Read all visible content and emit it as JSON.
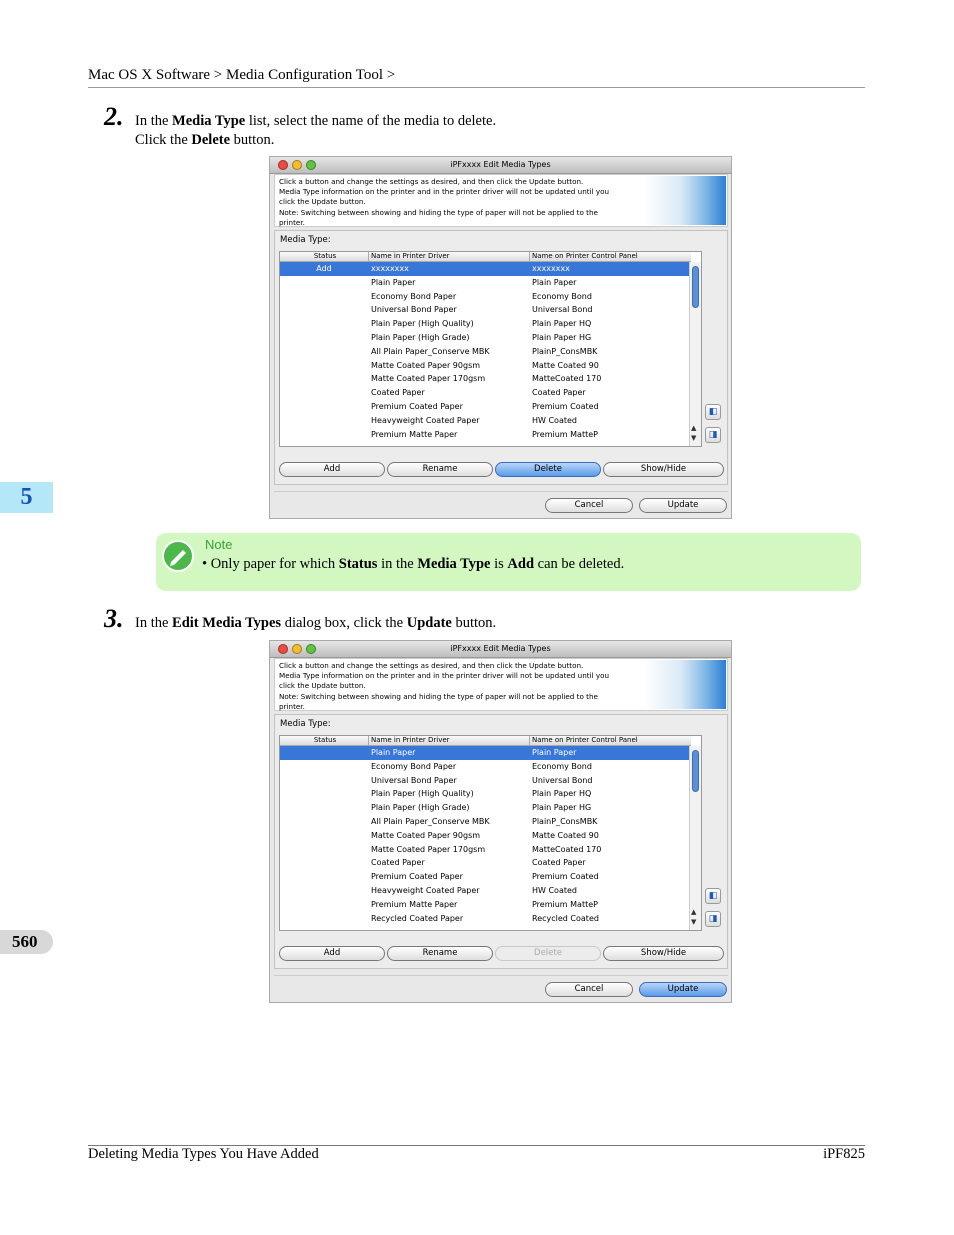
{
  "header": {
    "breadcrumb": "Mac OS X Software > Media Configuration Tool >"
  },
  "chapter_tab": "5",
  "page_number": "560",
  "steps": [
    {
      "number": "2.",
      "line1_pre": "In the ",
      "line1_bold": "Media Type",
      "line1_post": " list, select the name of the media to delete.",
      "line2_pre": "Click the ",
      "line2_bold": "Delete",
      "line2_post": " button."
    },
    {
      "number": "3.",
      "line1_pre": "In the ",
      "line1_bold": "Edit Media Types",
      "line1_mid": " dialog box, click the ",
      "line1_bold2": "Update",
      "line1_post": " button."
    }
  ],
  "note": {
    "label": "Note",
    "bullet": "•",
    "pre": "Only paper for which ",
    "b1": "Status",
    "mid1": " in the ",
    "b2": "Media Type",
    "mid2": " is ",
    "b3": "Add",
    "post": " can be deleted."
  },
  "dialog": {
    "title": "iPFxxxx Edit Media Types",
    "info_lines": [
      "Click a button and change the settings as desired, and then click the Update button.",
      "Media Type information on the printer and in the printer driver will not be updated until you",
      "click the Update button.",
      "Note: Switching between showing and hiding the type of paper will not be applied to the",
      "printer."
    ],
    "media_type_label": "Media Type:",
    "col_status": "Status",
    "col_driver": "Name in Printer Driver",
    "col_panel": "Name on Printer Control Panel",
    "btn_add": "Add",
    "btn_rename": "Rename",
    "btn_delete": "Delete",
    "btn_showhide": "Show/Hide",
    "btn_cancel": "Cancel",
    "btn_update": "Update"
  },
  "dialog1_rows": [
    {
      "status": "Add",
      "driver": "xxxxxxxx",
      "panel": "xxxxxxxx",
      "selected": true
    },
    {
      "status": "",
      "driver": "Plain Paper",
      "panel": "Plain Paper"
    },
    {
      "status": "",
      "driver": "Economy Bond Paper",
      "panel": "Economy Bond"
    },
    {
      "status": "",
      "driver": "Universal Bond Paper",
      "panel": "Universal Bond"
    },
    {
      "status": "",
      "driver": "Plain Paper (High Quality)",
      "panel": "Plain Paper HQ"
    },
    {
      "status": "",
      "driver": "Plain Paper (High Grade)",
      "panel": "Plain Paper HG"
    },
    {
      "status": "",
      "driver": "All Plain Paper_Conserve MBK",
      "panel": "PlainP_ConsMBK"
    },
    {
      "status": "",
      "driver": "Matte Coated Paper 90gsm",
      "panel": "Matte Coated 90"
    },
    {
      "status": "",
      "driver": "Matte Coated Paper 170gsm",
      "panel": "MatteCoated 170"
    },
    {
      "status": "",
      "driver": "Coated Paper",
      "panel": "Coated Paper"
    },
    {
      "status": "",
      "driver": "Premium Coated Paper",
      "panel": "Premium Coated"
    },
    {
      "status": "",
      "driver": "Heavyweight Coated Paper",
      "panel": "HW Coated"
    },
    {
      "status": "",
      "driver": "Premium Matte Paper",
      "panel": "Premium MatteP"
    }
  ],
  "dialog2_rows": [
    {
      "status": "",
      "driver": "Plain Paper",
      "panel": "Plain Paper",
      "selected": true
    },
    {
      "status": "",
      "driver": "Economy Bond Paper",
      "panel": "Economy Bond"
    },
    {
      "status": "",
      "driver": "Universal Bond Paper",
      "panel": "Universal Bond"
    },
    {
      "status": "",
      "driver": "Plain Paper (High Quality)",
      "panel": "Plain Paper HQ"
    },
    {
      "status": "",
      "driver": "Plain Paper (High Grade)",
      "panel": "Plain Paper HG"
    },
    {
      "status": "",
      "driver": "All Plain Paper_Conserve MBK",
      "panel": "PlainP_ConsMBK"
    },
    {
      "status": "",
      "driver": "Matte Coated Paper 90gsm",
      "panel": "Matte Coated 90"
    },
    {
      "status": "",
      "driver": "Matte Coated Paper 170gsm",
      "panel": "MatteCoated 170"
    },
    {
      "status": "",
      "driver": "Coated Paper",
      "panel": "Coated Paper"
    },
    {
      "status": "",
      "driver": "Premium Coated Paper",
      "panel": "Premium Coated"
    },
    {
      "status": "",
      "driver": "Heavyweight Coated Paper",
      "panel": "HW Coated"
    },
    {
      "status": "",
      "driver": "Premium Matte Paper",
      "panel": "Premium MatteP"
    },
    {
      "status": "",
      "driver": "Recycled Coated Paper",
      "panel": "Recycled Coated"
    }
  ],
  "footer": {
    "left": "Deleting Media Types You Have Added",
    "right": "iPF825"
  },
  "colors": {
    "selection": "#3877d8",
    "note_bg": "#d2f7c1",
    "chapter_tab": "#b4e8f8"
  }
}
